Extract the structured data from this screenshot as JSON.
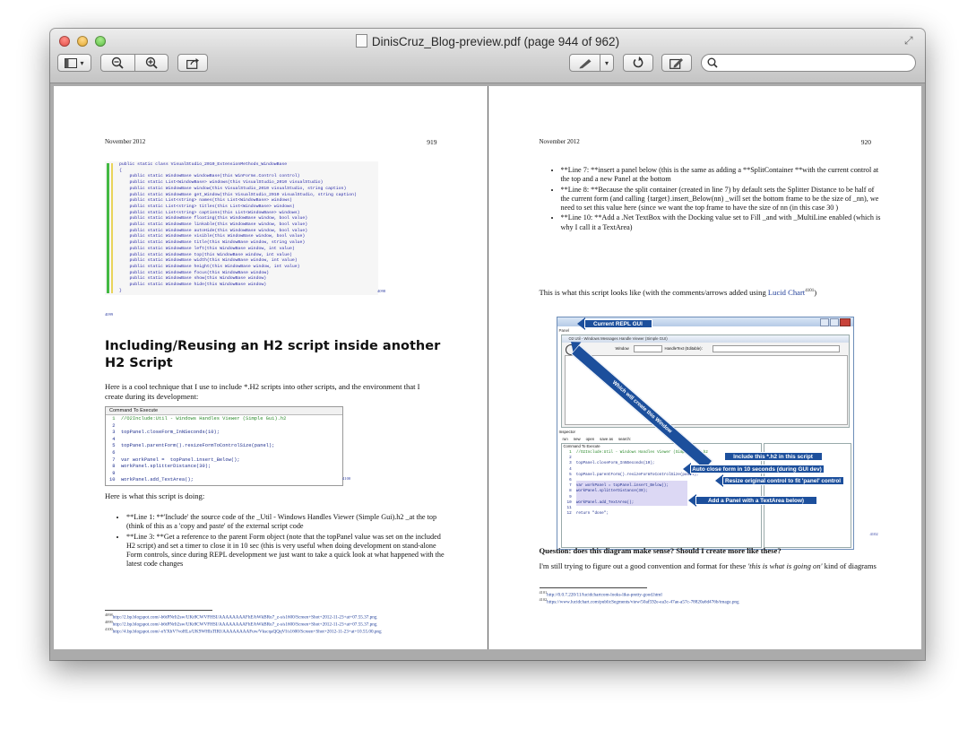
{
  "window": {
    "title": "DinisCruz_Blog-preview.pdf (page 944 of 962)"
  },
  "toolbar": {
    "search_placeholder": ""
  },
  "left_page": {
    "header_date": "November 2012",
    "page_number": "919",
    "code_lines": [
      "public static class VisualStudio_2010_ExtensionMethods_WindowBase",
      "{",
      "    public static WindowBase windowBase(this WinForms.Control control)",
      "    public static List<WindowBase> windows(this VisualStudio_2010 visualStudio)",
      "    public static WindowBase window(this VisualStudio_2010 visualStudio, string caption)",
      "    public static WindowBase get_Window(this VisualStudio_2010 visualStudio, string caption)",
      "    public static List<string> names(this List<WindowBase> windows)",
      "    public static List<string> titles(this List<WindowBase> windows)",
      "    public static List<string> captions(this List<WindowBase> windows)",
      "    public static WindowBase floating(this WindowBase window, bool value)",
      "    public static WindowBase linkable(this WindowBase window, bool value)",
      "    public static WindowBase autoHide(this WindowBase window, bool value)",
      "    public static WindowBase visible(this WindowBase window, bool value)",
      "    public static WindowBase title(this WindowBase window, string value)",
      "    public static WindowBase left(this WindowBase window, int value)",
      "    public static WindowBase top(this WindowBase window, int value)",
      "    public static WindowBase width(this WindowBase window, int value)",
      "    public static WindowBase height(this WindowBase window, int value)",
      "    public static WindowBase focus(this WindowBase window)",
      "    public static WindowBase show(this WindowBase window)",
      "    public static WindowBase hide(this WindowBase window)",
      "}"
    ],
    "fig_ref_1": "4098",
    "fig_ref_2": "4099",
    "heading": "Including/Reusing an H2 script inside another H2 Script",
    "intro": "Here is a cool technique that I use to include *.H2 scripts into other scripts, and the environment that I create during its development:",
    "script_box_title": "Command To Execute",
    "script_lines": [
      "//O2Include:Util - Windows Handles Viewer (Simple Gui).h2",
      "",
      "topPanel.closeForm_InNSeconds(10);",
      "",
      "topPanel.parentForm().resizeFormToControlSize(panel);",
      "",
      "var workPanel =  topPanel.insert_Below();",
      "workPanel.splitterDistance(30);",
      "",
      "workPanel.add_TextArea();"
    ],
    "fig_ref_3": "4100",
    "doing": "Here is what this script is doing:",
    "bullets": [
      "**Line 1: **'Include' the source code of the _Util - Windows Handles Viewer (Simple Gui).h2 _at the top (think of this as a 'copy and paste' of the external script code",
      "**Line 3: **Get a reference to the parent Form object (note that the topPanel value was set on the included H2 script) and set a timer to close it in 10 sec (this is very useful when doing development on stand-alone Form controls, since during REPL development we just want to take a quick look at what happened with the latest code changes"
    ],
    "footnotes": [
      {
        "num": "4098",
        "url": "http://2.bp.blogspot.com/-b6tPNrIi2sw/UKt8CWVFHSI/AAAAAAAAFhE/hWkBRu7_z-s/s1600/Screen+Shot+2012-11-23+at+07.55.37.png"
      },
      {
        "num": "4099",
        "url": "http://2.bp.blogspot.com/-b6tPNrIi2sw/UKt8CWVFHSI/AAAAAAAAFhE/hWkBRu7_z-s/s1600/Screen+Shot+2012-11-23+at+07.55.37.png"
      },
      {
        "num": "4100",
        "url": "http://4.bp.blogspot.com/-oYXhV7voHLs/UK9WHIsTIRI/AAAAAAAAFuw/VkscqaQQqVI/s1600/Screen+Shot+2012-11-23+at+10.55.00.png"
      }
    ]
  },
  "right_page": {
    "header_date": "November 2012",
    "page_number": "920",
    "bullets": [
      "**Line 7:  **insert a panel below (this is the same as adding a **SplitContainer **with the current control at the top and a new Panel at the bottom",
      "**Line 8: **Because the split container (created in line 7) by default sets the Splitter Distance to be half of the current form (and calling {target}.insert_Below(nn) _will set the bottom frame to be the size of _nn), we need to set this value here (since we want the top frame to have the size of nn (in this case 30 )",
      "**Line 10: **Add a .Net TextBox with the Docking value set to Fill _and with _MultiLine enabled (which is why I call it a TextArea)"
    ],
    "script_looks": "This is what this script looks like (with the comments/arrows added using ",
    "lucid_link": "Lucid Chart",
    "lucid_ref": "4101",
    "after_link": ")",
    "screenshot": {
      "window_title": "O2 Util - Windows Messages Handle Viewer (Simple GUI)",
      "panel_label": "Panel",
      "window_label": "Window",
      "handle_text_label": "HandleText (Editable):",
      "inspector_label": "Inspector",
      "toolbar_items": [
        "run",
        "new",
        "open",
        "save as",
        "search:"
      ],
      "command_label": "Command To Execute",
      "code_lines": [
        "//O2Include:Util - Windows Handles Viewer (Simple Gui).h2",
        "",
        "topPanel.closeForm_InNSeconds(10);",
        "",
        "topPanel.parentForm().resizeFormToControlSize(panel);",
        "",
        "var workPanel = topPanel.insert_Below();",
        "workPanel.splitterDistance(30);",
        "",
        "workPanel.add_TextArea();",
        "",
        "return \"done\";"
      ],
      "annotations": {
        "current_repl": "Current REPL GUI",
        "diagonal": "Which will create this Window",
        "include": "Include this *.h2 in this script",
        "auto_close": "Auto close form in 10 seconds (during GUI dev)",
        "resize": "Resize original control to fit 'panel' control",
        "add_panel": "Add a Panel with a TextArea below)"
      },
      "side_text": "done"
    },
    "fig_ref_4": "4102",
    "question": "Question: does this diagram make sense? Should I create more like these?",
    "trying": "I'm still trying to figure out a good convention and format for these ",
    "trying_em": "'this is what is going on'",
    "trying_end": " kind of diagrams",
    "footnotes": [
      {
        "num": "4101",
        "url": "http://0.0.7.220/11/lucidchartcom-looks-like-pretty-good.html"
      },
      {
        "num": "4102",
        "url": "https://www.lucidchart.com/publicSegments/view/50af592e-ea3c-47ae-a57c-78820a6d476b/image.png"
      }
    ]
  }
}
